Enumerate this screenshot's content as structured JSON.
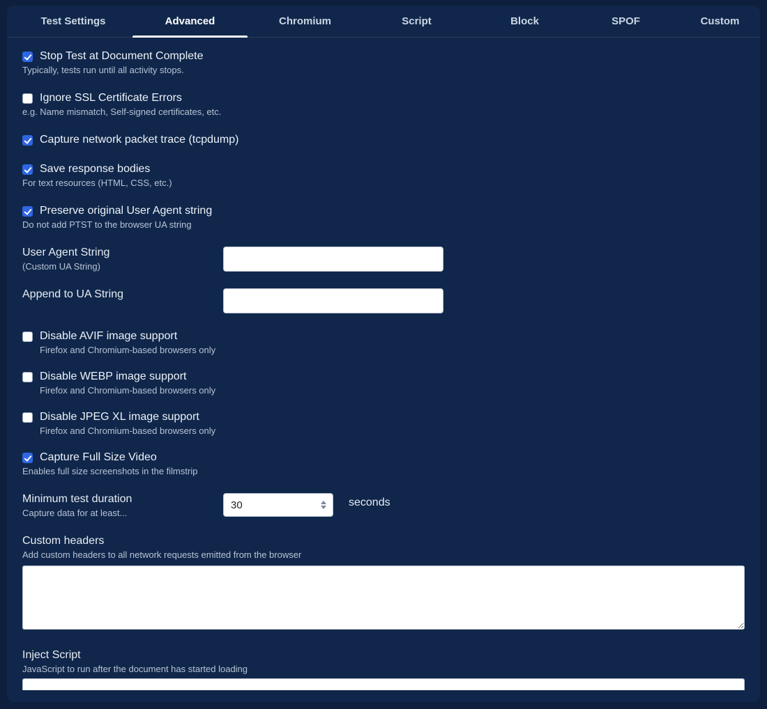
{
  "tabs": [
    {
      "label": "Test Settings",
      "active": false
    },
    {
      "label": "Advanced",
      "active": true
    },
    {
      "label": "Chromium",
      "active": false
    },
    {
      "label": "Script",
      "active": false
    },
    {
      "label": "Block",
      "active": false
    },
    {
      "label": "SPOF",
      "active": false
    },
    {
      "label": "Custom",
      "active": false
    }
  ],
  "options": {
    "stop_doc_complete": {
      "label": "Stop Test at Document Complete",
      "sub": "Typically, tests run until all activity stops.",
      "checked": true
    },
    "ignore_ssl": {
      "label": "Ignore SSL Certificate Errors",
      "sub": "e.g. Name mismatch, Self-signed certificates, etc.",
      "checked": false
    },
    "tcpdump": {
      "label": "Capture network packet trace (tcpdump)",
      "sub": "",
      "checked": true
    },
    "save_bodies": {
      "label": "Save response bodies",
      "sub": "For text resources (HTML, CSS, etc.)",
      "checked": true
    },
    "preserve_ua": {
      "label": "Preserve original User Agent string",
      "sub": "Do not add PTST to the browser UA string",
      "checked": true
    },
    "disable_avif": {
      "label": "Disable AVIF image support",
      "sub": "Firefox and Chromium-based browsers only",
      "checked": false
    },
    "disable_webp": {
      "label": "Disable WEBP image support",
      "sub": "Firefox and Chromium-based browsers only",
      "checked": false
    },
    "disable_jxl": {
      "label": "Disable JPEG XL image support",
      "sub": "Firefox and Chromium-based browsers only",
      "checked": false
    },
    "full_video": {
      "label": "Capture Full Size Video",
      "sub": "Enables full size screenshots in the filmstrip",
      "checked": true
    }
  },
  "ua_string": {
    "label": "User Agent String",
    "sub": "(Custom UA String)",
    "value": ""
  },
  "append_ua": {
    "label": "Append to UA String",
    "value": ""
  },
  "min_duration": {
    "label": "Minimum test duration",
    "sub": "Capture data for at least...",
    "value": "30",
    "unit": "seconds"
  },
  "custom_headers": {
    "label": "Custom headers",
    "sub": "Add custom headers to all network requests emitted from the browser",
    "value": ""
  },
  "inject_script": {
    "label": "Inject Script",
    "sub": "JavaScript to run after the document has started loading",
    "value": ""
  }
}
